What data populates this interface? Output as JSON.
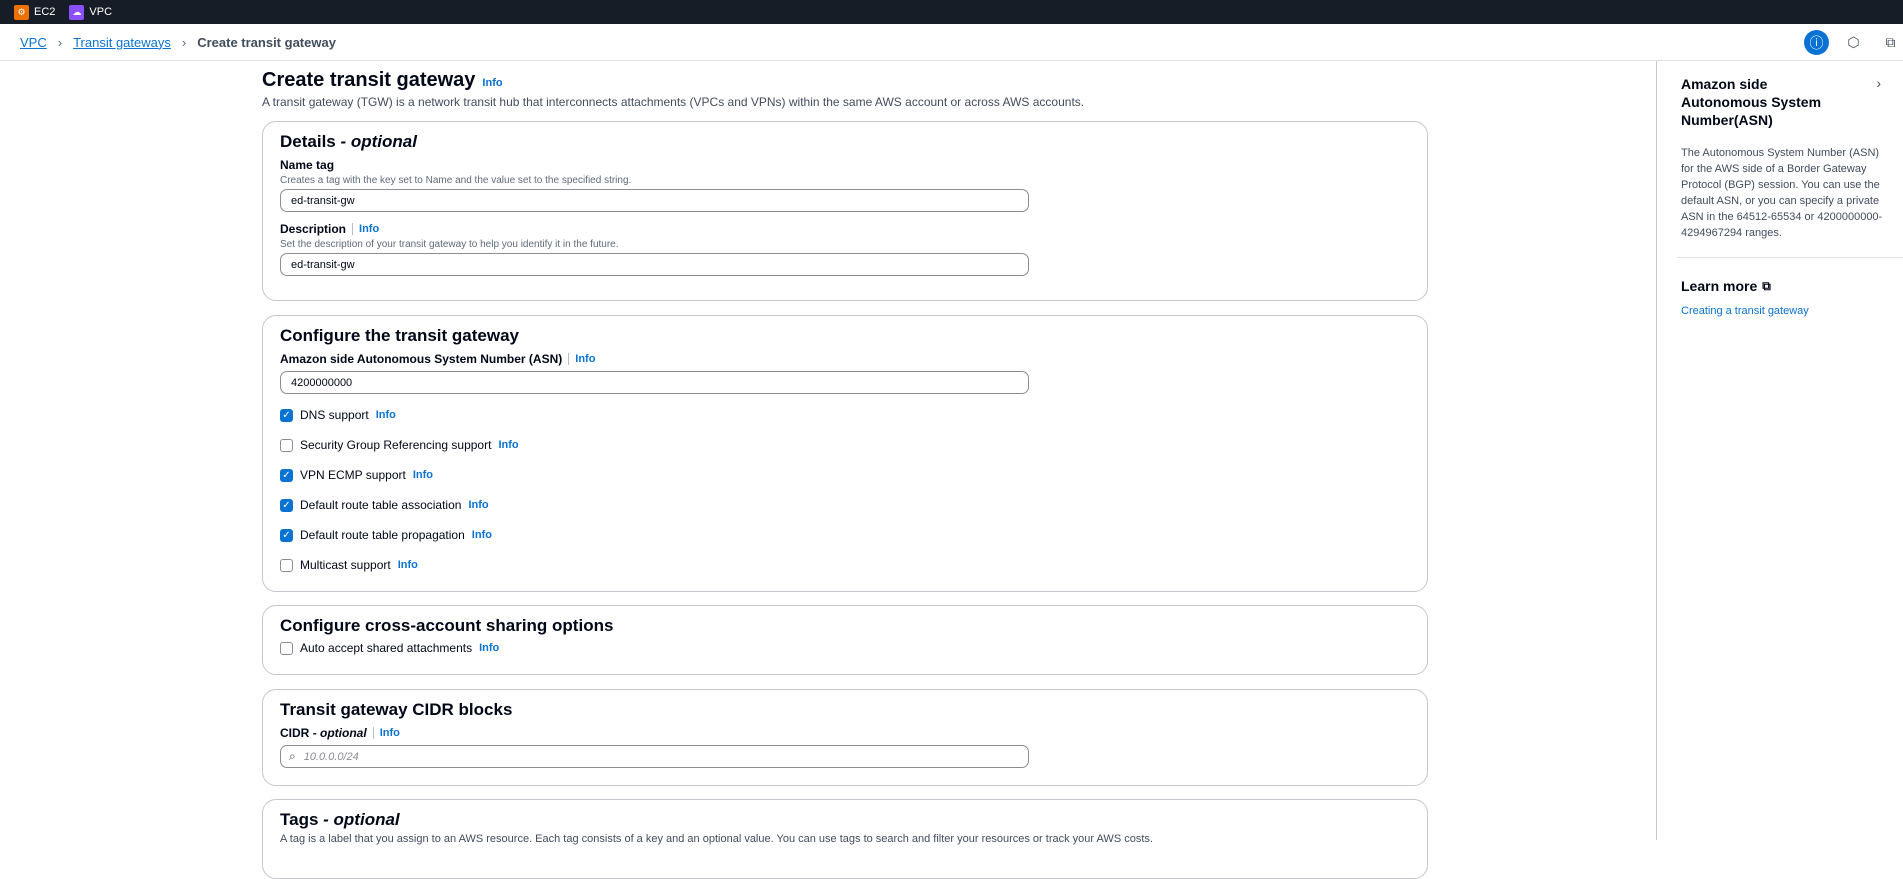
{
  "topbar": {
    "services": [
      {
        "label": "EC2",
        "icon": "ec2-icon",
        "color": "#ed7100"
      },
      {
        "label": "VPC",
        "icon": "vpc-icon",
        "color": "#8c4fff"
      }
    ]
  },
  "breadcrumb": {
    "items": [
      "VPC",
      "Transit gateways"
    ],
    "current": "Create transit gateway"
  },
  "page": {
    "title": "Create transit gateway",
    "info": "Info",
    "description": "A transit gateway (TGW) is a network transit hub that interconnects attachments (VPCs and VPNs) within the same AWS account or across AWS accounts."
  },
  "details": {
    "title": "Details",
    "title_suffix": "- optional",
    "name_tag_label": "Name tag",
    "name_tag_hint": "Creates a tag with the key set to Name and the value set to the specified string.",
    "name_tag_value": "ed-transit-gw",
    "description_label": "Description",
    "description_info": "Info",
    "description_hint": "Set the description of your transit gateway to help you identify it in the future.",
    "description_value": "ed-transit-gw"
  },
  "configure": {
    "title": "Configure the transit gateway",
    "asn_label": "Amazon side Autonomous System Number (ASN)",
    "asn_info": "Info",
    "asn_value": "4200000000",
    "options": [
      {
        "label": "DNS support",
        "info": "Info",
        "checked": true
      },
      {
        "label": "Security Group Referencing support",
        "info": "Info",
        "checked": false
      },
      {
        "label": "VPN ECMP support",
        "info": "Info",
        "checked": true
      },
      {
        "label": "Default route table association",
        "info": "Info",
        "checked": true
      },
      {
        "label": "Default route table propagation",
        "info": "Info",
        "checked": true
      },
      {
        "label": "Multicast support",
        "info": "Info",
        "checked": false
      }
    ]
  },
  "sharing": {
    "title": "Configure cross-account sharing options",
    "option_label": "Auto accept shared attachments",
    "option_info": "Info",
    "checked": false
  },
  "cidr": {
    "title": "Transit gateway CIDR blocks",
    "label": "CIDR",
    "label_suffix": "- optional",
    "info": "Info",
    "placeholder": "10.0.0.0/24"
  },
  "tags": {
    "title": "Tags",
    "title_suffix": "- optional",
    "description": "A tag is a label that you assign to an AWS resource. Each tag consists of a key and an optional value. You can use tags to search and filter your resources or track your AWS costs."
  },
  "help_panel": {
    "title": "Amazon side Autonomous System Number(ASN)",
    "body": "The Autonomous System Number (ASN) for the AWS side of a Border Gateway Protocol (BGP) session. You can use the default ASN, or you can specify a private ASN in the 64512-65534 or 4200000000-4294967294 ranges.",
    "learn_more": "Learn more",
    "link": "Creating a transit gateway"
  }
}
